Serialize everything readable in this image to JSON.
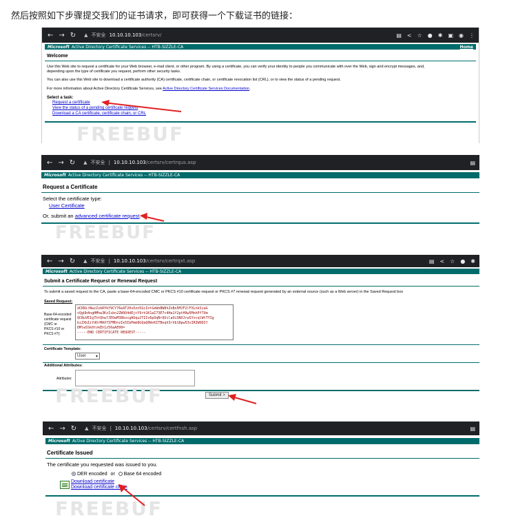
{
  "intro": "然后按照如下步骤提交我们的证书请求，即可获得一个下载证书的链接：",
  "watermark": "FREEBUF",
  "colors": {
    "banner": "#006b6b",
    "arrow": "#e02020",
    "link": "#0000cc",
    "chrome": "#202124"
  },
  "shot1": {
    "insecure": "不安全",
    "host": "10.10.10.103",
    "path": "/certsrv/",
    "banner_brand": "Microsoft",
    "banner_text": "Active Directory Certificate Services  --  HTB-SIZZLE-CA",
    "home": "Home",
    "heading": "Welcome",
    "p1": "Use this Web site to request a certificate for your Web browser, e-mail client, or other program. By using a certificate, you can verify your identity to people you communicate with over the Web, sign and encrypt messages, and,",
    "p1b": "depending upon the type of certificate you request, perform other security tasks.",
    "p2": "You can also use this Web site to download a certificate authority (CA) certificate, certificate chain, or certificate revocation list (CRL), or to view the status of a pending request.",
    "p3": "For more information about Active Directory Certificate Services, see",
    "p3_link": "Active Directory Certificate Services Documentation",
    "task_label": "Select a task:",
    "tasks": [
      "Request a certificate",
      "View the status of a pending certificate request",
      "Download a CA certificate, certificate chain, or CRL"
    ]
  },
  "shot2": {
    "insecure": "不安全",
    "host": "10.10.10.103",
    "path": "/certsrv/certrqus.asp",
    "banner_brand": "Microsoft",
    "banner_text": "Active Directory Certificate Services  --  HTB-SIZZLE-CA",
    "heading": "Request a Certificate",
    "select_type": "Select the certificate type:",
    "user_cert": "User Certificate",
    "or_submit": "Or, submit an",
    "advanced": "advanced certificate request"
  },
  "shot3": {
    "insecure": "不安全",
    "host": "10.10.10.103",
    "path": "/certsrv/certrqxt.asp",
    "banner_brand": "Microsoft",
    "banner_text": "Active Directory Certificate Services  --  HTB-SIZZLE-CA",
    "heading": "Submit a Certificate Request or Renewal Request",
    "desc": "To submit a saved request to the CA, paste a base-64-encoded CMC or PKCS #10 certificate request or PKCS #7 renewal request generated by an external source (such as a Web server) in the Saved Request box",
    "saved_request": "Saved Request:",
    "b64_label": [
      "Base-64-encoded",
      "certificate request",
      "(CMC or",
      "PKCS #10 or",
      "PKCS #7):"
    ],
    "csr_lines": [
      "dCKNirNwzZvbRYbY9CY76eAT20vOzn5GcIntGeWnBW8hZnBn5MJF2lFXLnkSiaG",
      "+QgUb4ngHMhw3KzIsbn2ZW9O4dEj+Y9rh1K1aI73E7+4Ha1f2ptH9w5MnhPf7Um",
      "QCBuVEIg7htQhw7JEOwM38bvcgAUqu2TIIv6pOqNrQUilaOiSNXJrwSYxcqlWtTYIg",
      "biZXbIiYdOrMAX7IFMDnzIe5IbPmm8GQaQ0WvKITBeqh3rVb18pw53vIRIWODIf",
      "DMlwSSk0tvkEh1z50aAE00=",
      "-----END CERTIFICATE REQUEST-----"
    ],
    "template_label": "Certificate Template:",
    "template_value": "User",
    "additional": "Additional Attributes:",
    "attributes": "Attributes:",
    "submit": "Submit >"
  },
  "shot4": {
    "insecure": "不安全",
    "host": "10.10.10.103",
    "path": "/certsrv/certfnsh.asp",
    "banner_brand": "Microsoft",
    "banner_text": "Active Directory Certificate Services  --  HTB-SIZZLE-CA",
    "heading": "Certificate Issued",
    "issued_text": "The certificate you requested was issued to you.",
    "der": "DER encoded",
    "or": "or",
    "b64": "Base 64 encoded",
    "download_cert": "Download certificate",
    "download_chain": "Download certificate chain"
  }
}
